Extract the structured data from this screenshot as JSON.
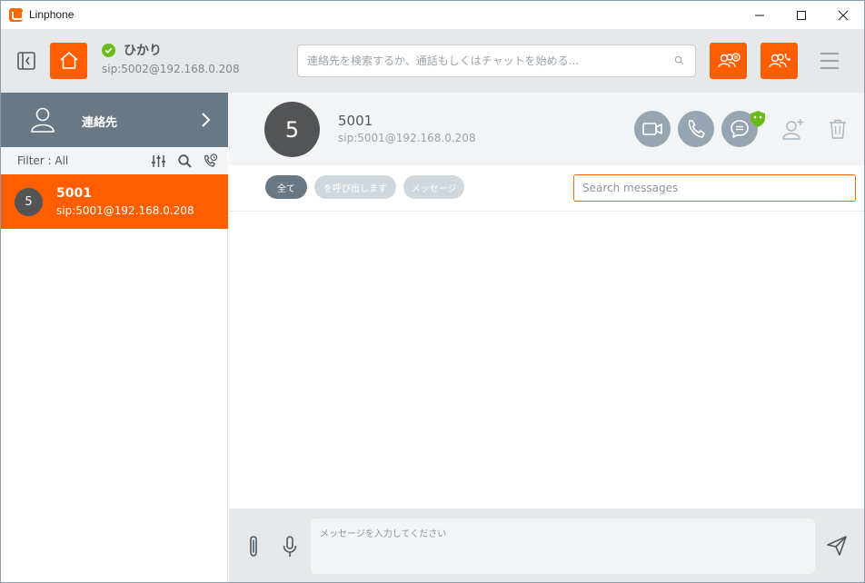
{
  "window": {
    "title": "Linphone"
  },
  "account": {
    "name": "ひかり",
    "sip": "sip:5002@192.168.0.208",
    "status": "online"
  },
  "search": {
    "placeholder": "連絡先を検索するか、通話もしくはチャットを始める..."
  },
  "sidebar": {
    "contacts_label": "連絡先",
    "filter_label": "Filter : All",
    "contacts": [
      {
        "avatar": "5",
        "name": "5001",
        "sip": "sip:5001@192.168.0.208",
        "selected": true
      }
    ]
  },
  "conversation": {
    "avatar": "5",
    "name": "5001",
    "sip": "sip:5001@192.168.0.208",
    "tabs": [
      {
        "label": "全て",
        "active": true
      },
      {
        "label": "を呼び出します",
        "active": false
      },
      {
        "label": "メッセージ",
        "active": false
      }
    ],
    "search_placeholder": "Search messages"
  },
  "composer": {
    "placeholder": "メッセージを入力してください"
  },
  "colors": {
    "accent": "#ff5e00",
    "sidebar_nav": "#687885",
    "round_button": "#96a5b1",
    "status_online": "#6bbc1a"
  }
}
